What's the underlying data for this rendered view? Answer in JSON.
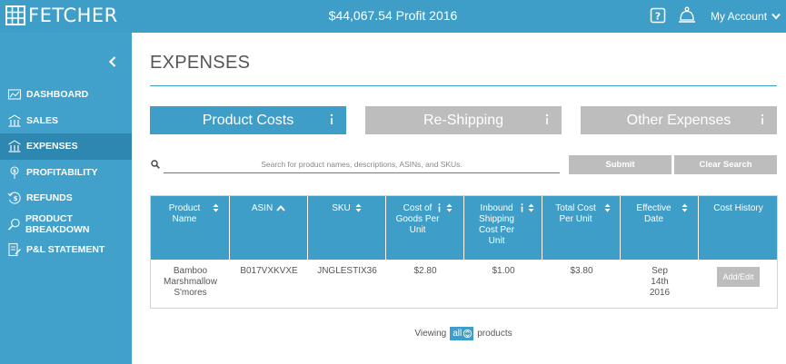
{
  "header": {
    "brand": "FETCHER",
    "profit": "$44,067.54 Profit 2016",
    "account_label": "My Account"
  },
  "sidebar": {
    "items": [
      {
        "label": "DASHBOARD",
        "icon": "dashboard-icon",
        "active": false
      },
      {
        "label": "SALES",
        "icon": "sales-icon",
        "active": false
      },
      {
        "label": "EXPENSES",
        "icon": "expenses-icon",
        "active": true
      },
      {
        "label": "PROFITABILITY",
        "icon": "profitability-icon",
        "active": false
      },
      {
        "label": "REFUNDS",
        "icon": "refunds-icon",
        "active": false
      },
      {
        "label": "PRODUCT BREAKDOWN",
        "icon": "magnifier-icon",
        "active": false
      },
      {
        "label": "P&L STATEMENT",
        "icon": "statement-icon",
        "active": false
      }
    ]
  },
  "main": {
    "title": "EXPENSES",
    "tabs": [
      {
        "label": "Product Costs",
        "active": true
      },
      {
        "label": "Re-Shipping",
        "active": false
      },
      {
        "label": "Other Expenses",
        "active": false
      }
    ],
    "search": {
      "placeholder": "Search for product names, descriptions, ASINs, and SKUs.",
      "value": ""
    },
    "submit_label": "Submit",
    "clear_label": "Clear Search"
  },
  "table": {
    "columns": [
      "Product Name",
      "ASIN",
      "SKU",
      "Cost of Goods Per Unit",
      "Inbound Shipping Cost Per Unit",
      "Total Cost Per Unit",
      "Effective Date",
      "Cost History"
    ],
    "rows": [
      {
        "product_name": "Bamboo Marshmallow S'mores",
        "asin": "B017VXKVXE",
        "sku": "JNGLESTIX36",
        "cogs": "$2.80",
        "inbound": "$1.00",
        "total": "$3.80",
        "date": "Sep 14th 2016",
        "action": "Add/Edit"
      }
    ]
  },
  "footer": {
    "viewing_prefix": "Viewing",
    "viewing_value": "all",
    "viewing_suffix": "products"
  },
  "colors": {
    "accent": "#3f9ec7",
    "sidebar_active": "#2e87b0",
    "button_grey": "#bdbdbd"
  }
}
